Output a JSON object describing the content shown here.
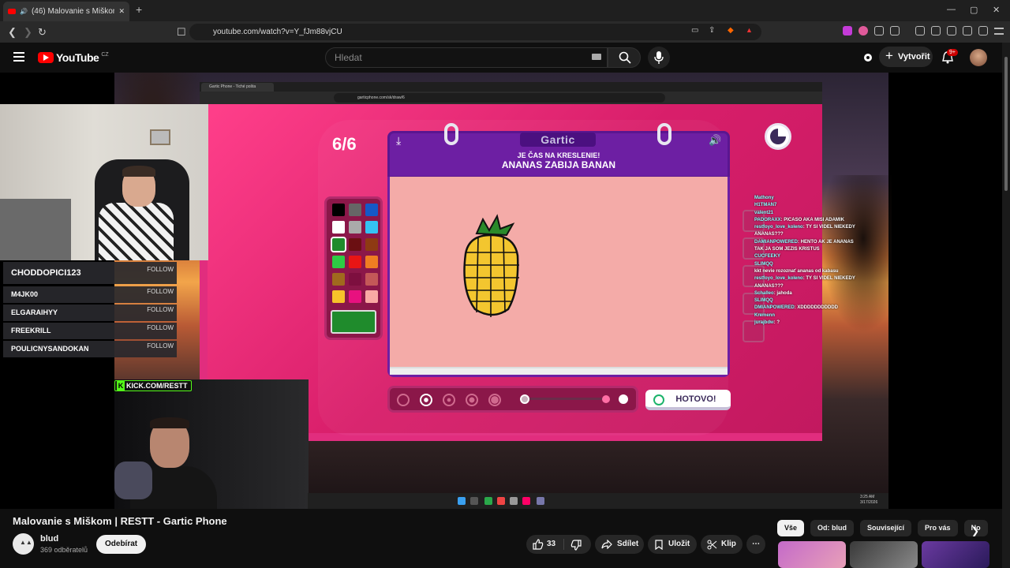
{
  "browser": {
    "tab_title": "(46) Malovanie s Miškom | RES",
    "tab_close": "✕",
    "new_tab": "+",
    "url": "youtube.com/watch?v=Y_fJm88vjCU",
    "window": {
      "min": "—",
      "max": "▢",
      "close": "✕"
    }
  },
  "youtube": {
    "logo_text": "YouTube",
    "country": "CZ",
    "search_placeholder": "Hledat",
    "create_label": "Vytvořit",
    "notif_badge": "9+"
  },
  "stream": {
    "followers": [
      {
        "name": "CHODDOPICI123",
        "follow": "FOLLOW"
      },
      {
        "name": "M4JK00",
        "follow": "FOLLOW"
      },
      {
        "name": "ELGARAIHYY",
        "follow": "FOLLOW"
      },
      {
        "name": "FREEKRILL",
        "follow": "FOLLOW"
      },
      {
        "name": "POULICNYSANDOKAN",
        "follow": "FOLLOW"
      }
    ],
    "kick_tag": "KICK.COM/RESTT"
  },
  "inner_browser": {
    "tab_title": "Gartic Phone - Tiché pošta",
    "url": "garticphone.com/sk/draw/6"
  },
  "game": {
    "counter": "6/6",
    "logo": "Gartic",
    "prompt_sub": "JE ČAS NA KRESLENIE!",
    "prompt_main": "ANANAS ZABIJA BANAN",
    "done_label": "HOTOVO!",
    "palette": [
      "#000000",
      "#666666",
      "#1559c7",
      "#ffffff",
      "#aaaaaa",
      "#35c2f2",
      "#1f8b2c",
      "#6b0f12",
      "#8e3a12",
      "#2dcc44",
      "#e81515",
      "#f07d22",
      "#a0691e",
      "#7d0f3f",
      "#c45858",
      "#f7c22a",
      "#e8117f",
      "#f9a9a4"
    ],
    "selected_color": "#1f8b2c"
  },
  "chat": [
    {
      "user": "Mathony",
      "text": ""
    },
    {
      "user": "H1TMAN7",
      "text": ""
    },
    {
      "user": "valent21",
      "text": ""
    },
    {
      "user": "PADORAXX",
      "text": "PICASO AKA MISI ADAMIK"
    },
    {
      "user": "restfoyo_love_koleno",
      "text": "TY SI VIDEL NIEKEDY ANANAS???"
    },
    {
      "user": "DAMIANPOWERED",
      "text": "HENTO AK JE ANANAS TAK JA SOM JEZIS KRISTUS"
    },
    {
      "user": "CUCFEEKY",
      "text": ""
    },
    {
      "user": "SLIMQQ",
      "text": ""
    },
    {
      "user": "",
      "text": "kkt nevie rozozn​ať ananas od kabasu"
    },
    {
      "user": "restfoyo_love_koleno",
      "text": "TY SI VIDEL NIEKEDY ANANAS???"
    },
    {
      "user": "Schalleo",
      "text": "jahoda"
    },
    {
      "user": "SLIMQQ",
      "text": ""
    },
    {
      "user": "DMIANPOWERED",
      "text": "XDDDDDDDDDDD"
    },
    {
      "user": "Kremenn",
      "text": ""
    },
    {
      "user": "jurajbdw",
      "text": "?"
    }
  ],
  "taskbar": {
    "time": "3:25 AM",
    "date": "3/17/2026"
  },
  "video": {
    "title": "Malovanie s Miškom | RESTT - Gartic Phone",
    "channel": "blud",
    "subscribers": "369 odběratelů",
    "subscribe_label": "Odebírat",
    "likes": "33",
    "share_label": "Sdílet",
    "save_label": "Uložit",
    "clip_label": "Klip",
    "more_label": "⋯"
  },
  "chips": [
    "Vše",
    "Od: blud",
    "Související",
    "Pro vás",
    "No"
  ]
}
